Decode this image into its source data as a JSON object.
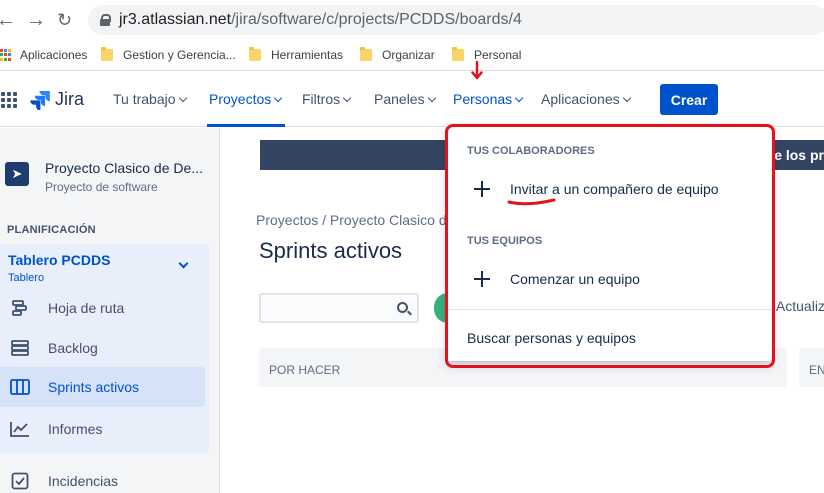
{
  "browser": {
    "url_host": "jr3.atlassian.net",
    "url_path": "/jira/software/c/projects/PCDDS/boards/4",
    "bookmarks": [
      {
        "label": "Aplicaciones",
        "icon": "apps-grid-icon"
      },
      {
        "label": "Gestion y Gerencia...",
        "icon": "folder-icon"
      },
      {
        "label": "Herramientas",
        "icon": "folder-icon"
      },
      {
        "label": "Organizar",
        "icon": "folder-icon"
      },
      {
        "label": "Personal",
        "icon": "folder-icon"
      }
    ]
  },
  "nav": {
    "logo": "Jira",
    "items": [
      {
        "label": "Tu trabajo"
      },
      {
        "label": "Proyectos"
      },
      {
        "label": "Filtros"
      },
      {
        "label": "Paneles"
      },
      {
        "label": "Personas"
      },
      {
        "label": "Aplicaciones"
      }
    ],
    "create_label": "Crear",
    "brand_color": "#0052cc"
  },
  "sidebar": {
    "project_name": "Proyecto Clasico de De...",
    "project_type": "Proyecto de software",
    "section_title": "PLANIFICACIÓN",
    "board_title": "Tablero PCDDS",
    "board_sub": "Tablero",
    "items": [
      {
        "label": "Hoja de ruta",
        "icon": "roadmap-icon"
      },
      {
        "label": "Backlog",
        "icon": "backlog-icon"
      },
      {
        "label": "Sprints activos",
        "icon": "board-columns-icon"
      },
      {
        "label": "Informes",
        "icon": "chart-line-icon"
      },
      {
        "label": "Incidencias",
        "icon": "issues-icon"
      }
    ]
  },
  "main": {
    "banner_text": "de los pr",
    "breadcrumb": "Proyectos  /  Proyecto Clasico d",
    "page_title": "Sprints activos",
    "actualiz_text": "e Actualiz",
    "columns": [
      {
        "label": "POR HACER"
      },
      {
        "label": "EN"
      }
    ]
  },
  "dropdown": {
    "section1": "TUS COLABORADORES",
    "invite": "Invitar a un compañero de equipo",
    "section2": "TUS EQUIPOS",
    "start_team": "Comenzar un equipo",
    "search_link": "Buscar personas y equipos"
  },
  "annotation_color": "#e3121c"
}
